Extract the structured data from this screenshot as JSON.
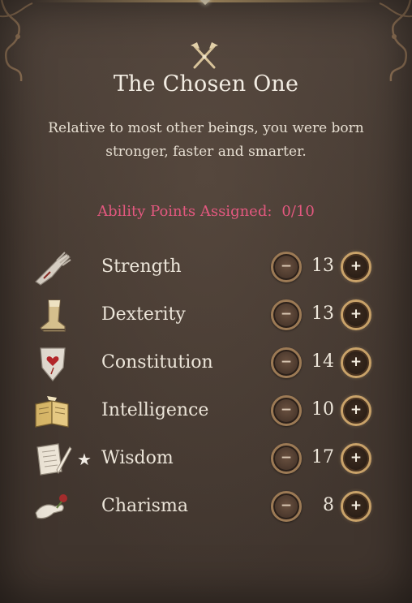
{
  "header": {
    "class_icon": "crossed-axes-icon",
    "title": "The Chosen One",
    "description": "Relative to most other beings, you were born stronger, faster and smarter."
  },
  "points": {
    "label": "Ability Points Assigned:",
    "value": "0/10"
  },
  "abilities": [
    {
      "name": "Strength",
      "value": "13",
      "icon": "gauntlet-icon",
      "starred": false
    },
    {
      "name": "Dexterity",
      "value": "13",
      "icon": "boot-icon",
      "starred": false
    },
    {
      "name": "Constitution",
      "value": "14",
      "icon": "shield-heart-icon",
      "starred": false
    },
    {
      "name": "Intelligence",
      "value": "10",
      "icon": "open-book-icon",
      "starred": false
    },
    {
      "name": "Wisdom",
      "value": "17",
      "icon": "scroll-quill-icon",
      "starred": true
    },
    {
      "name": "Charisma",
      "value": "8",
      "icon": "hand-rose-icon",
      "starred": false
    }
  ],
  "controls": {
    "minus_symbol": "−",
    "plus_symbol": "+",
    "star_symbol": "★"
  },
  "colors": {
    "points_accent": "#e3587f",
    "panel_bg": "#463a32",
    "button_gold": "#caa36a"
  }
}
